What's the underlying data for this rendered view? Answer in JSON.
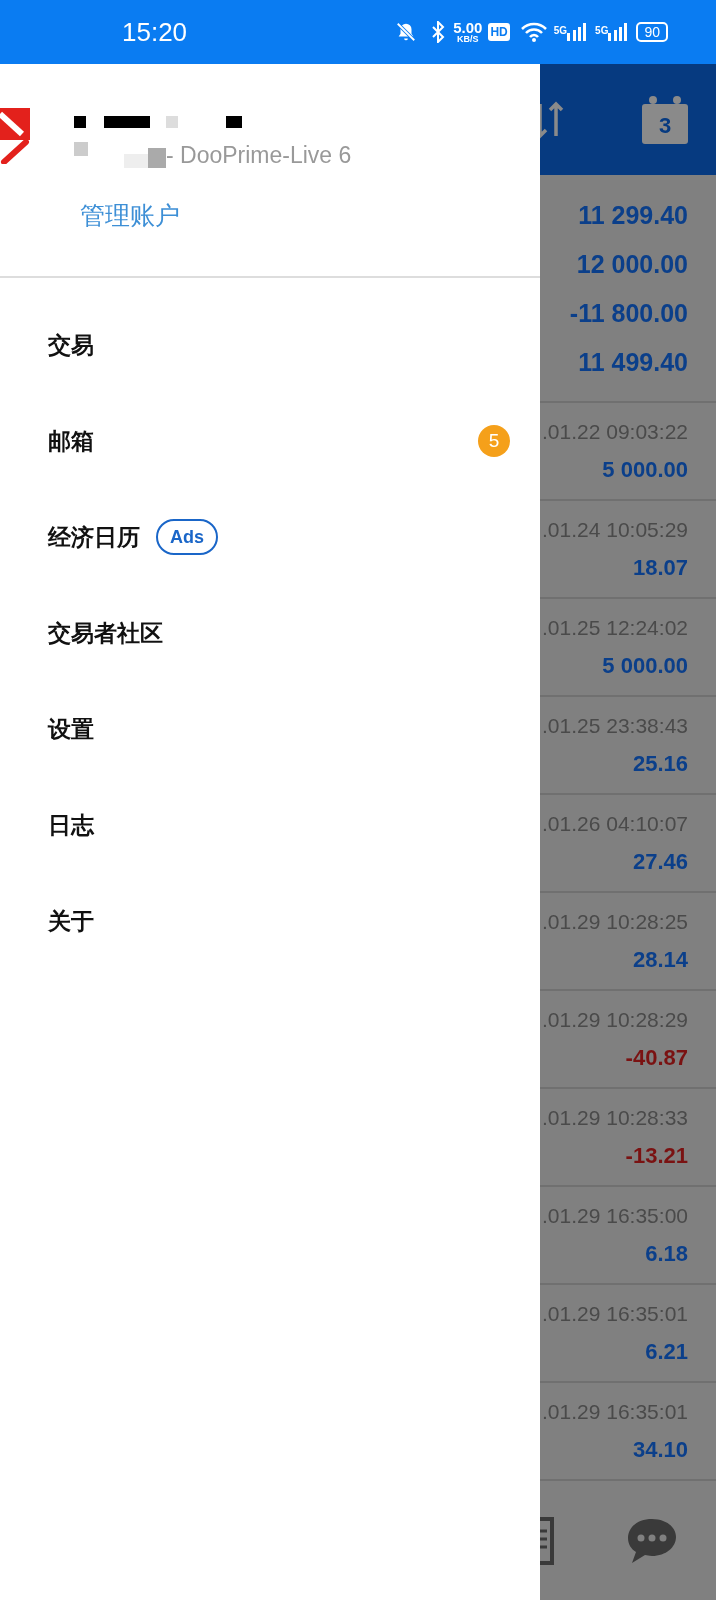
{
  "status_bar": {
    "time": "15:20",
    "speed": "5.00",
    "speed_unit": "KB/S",
    "hd": "HD",
    "network_labels": [
      "5G",
      "5G"
    ],
    "battery": "90"
  },
  "drawer": {
    "account_subtitle": "- DooPrime-Live 6",
    "manage_link": "管理账户",
    "menu": [
      {
        "label": "交易",
        "kind": "plain"
      },
      {
        "label": "邮箱",
        "kind": "badge",
        "badge": "5"
      },
      {
        "label": "经济日历",
        "kind": "tag",
        "tag": "Ads"
      },
      {
        "label": "交易者社区",
        "kind": "plain"
      },
      {
        "label": "设置",
        "kind": "plain"
      },
      {
        "label": "日志",
        "kind": "plain"
      },
      {
        "label": "关于",
        "kind": "plain"
      }
    ]
  },
  "background": {
    "calendar_day": "3",
    "summary": [
      "11 299.40",
      "12 000.00",
      "-11 800.00",
      "11 499.40"
    ],
    "trades": [
      {
        "time": ".01.22 09:03:22",
        "amount": "5 000.00",
        "loss": false
      },
      {
        "time": ".01.24 10:05:29",
        "amount": "18.07",
        "loss": false
      },
      {
        "time": ".01.25 12:24:02",
        "amount": "5 000.00",
        "loss": false
      },
      {
        "time": ".01.25 23:38:43",
        "amount": "25.16",
        "loss": false
      },
      {
        "time": ".01.26 04:10:07",
        "amount": "27.46",
        "loss": false
      },
      {
        "time": ".01.29 10:28:25",
        "amount": "28.14",
        "loss": false
      },
      {
        "time": ".01.29 10:28:29",
        "amount": "-40.87",
        "loss": true
      },
      {
        "time": ".01.29 10:28:33",
        "amount": "-13.21",
        "loss": true
      },
      {
        "time": ".01.29 16:35:00",
        "amount": "6.18",
        "loss": false
      },
      {
        "time": ".01.29 16:35:01",
        "amount": "6.21",
        "loss": false
      },
      {
        "time": ".01.29 16:35:01",
        "amount": "34.10",
        "loss": false
      }
    ]
  }
}
